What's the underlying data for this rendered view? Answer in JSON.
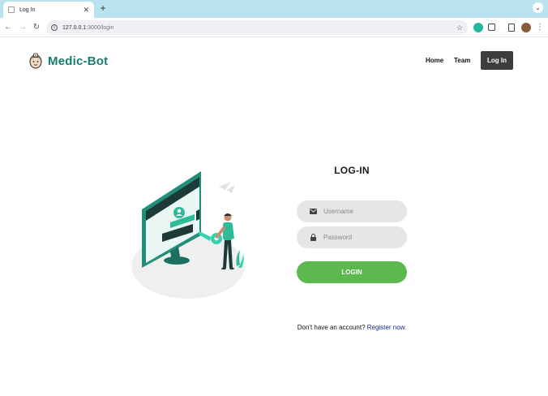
{
  "browser": {
    "tab_title": "Log In",
    "url_host": "127.0.0.1",
    "url_path": ":3000/login"
  },
  "site": {
    "brand": "Medic-Bot",
    "nav": {
      "home": "Home",
      "team": "Team",
      "login": "Log In"
    }
  },
  "form": {
    "title": "LOG-IN",
    "username_placeholder": "Username",
    "password_placeholder": "Password",
    "submit_label": "LOGIN",
    "signup_prompt": "Don't have an account?",
    "signup_link": "Register now."
  },
  "colors": {
    "brand": "#167d70",
    "accent_green": "#5cb94d",
    "nav_button": "#3d3d3d",
    "tabbar": "#b9e3ee"
  },
  "icons": [
    "back-arrow-icon",
    "forward-arrow-icon",
    "reload-icon",
    "site-info-icon",
    "star-icon",
    "envelope-icon",
    "lock-icon"
  ]
}
